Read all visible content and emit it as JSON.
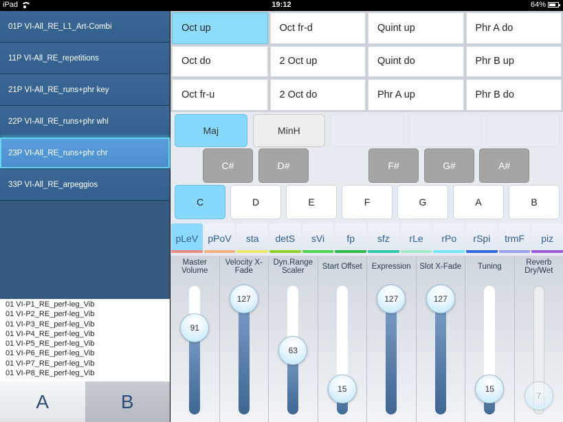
{
  "status_bar": {
    "device": "iPad",
    "time": "19:12",
    "battery": "64%",
    "battery_fraction": 0.64
  },
  "sidebar": {
    "presets": [
      {
        "label": "01P VI-All_RE_L1_Art-Combi",
        "selected": false
      },
      {
        "label": "11P VI-All_RE_repetitions",
        "selected": false
      },
      {
        "label": "21P VI-All_RE_runs+phr key",
        "selected": false
      },
      {
        "label": "22P VI-All_RE_runs+phr whl",
        "selected": false
      },
      {
        "label": "23P VI-All_RE_runs+phr chr",
        "selected": true
      },
      {
        "label": "33P VI-All_RE_arpeggios",
        "selected": false
      }
    ],
    "patches": [
      "01 VI-P1_RE_perf-leg_Vib",
      "01 VI-P2_RE_perf-leg_Vib",
      "01 VI-P3_RE_perf-leg_Vib",
      "01 VI-P4_RE_perf-leg_Vib",
      "01 VI-P5_RE_perf-leg_Vib",
      "01 VI-P6_RE_perf-leg_Vib",
      "01 VI-P7_RE_perf-leg_Vib",
      "01 VI-P8_RE_perf-leg_Vib"
    ],
    "ab": {
      "a_label": "A",
      "b_label": "B",
      "selected": "A"
    }
  },
  "patterns": {
    "items": [
      {
        "label": "Oct up",
        "active": true
      },
      {
        "label": "Oct fr-d",
        "active": false
      },
      {
        "label": "Quint up",
        "active": false
      },
      {
        "label": "Phr A do",
        "active": false
      },
      {
        "label": "Oct do",
        "active": false
      },
      {
        "label": "2 Oct up",
        "active": false
      },
      {
        "label": "Quint do",
        "active": false
      },
      {
        "label": "Phr B up",
        "active": false
      },
      {
        "label": "Oct fr-u",
        "active": false
      },
      {
        "label": "2 Oct do",
        "active": false
      },
      {
        "label": "Phr A up",
        "active": false
      },
      {
        "label": "Phr B do",
        "active": false
      }
    ]
  },
  "scales": {
    "items": [
      {
        "label": "Maj",
        "state": "active"
      },
      {
        "label": "MinH",
        "state": "normal"
      },
      {
        "label": "",
        "state": "empty"
      },
      {
        "label": "",
        "state": "empty"
      },
      {
        "label": "",
        "state": "empty"
      }
    ]
  },
  "keys": {
    "black": [
      "C#",
      "D#",
      "F#",
      "G#",
      "A#"
    ],
    "white": [
      "C",
      "D",
      "E",
      "F",
      "G",
      "A",
      "B"
    ],
    "selected": "C"
  },
  "articulations": {
    "items": [
      {
        "label": "pLeV",
        "color": "#f08a80",
        "active": true
      },
      {
        "label": "pPoV",
        "color": "#f5b082",
        "active": false
      },
      {
        "label": "sta",
        "color": "#ece86a",
        "active": false
      },
      {
        "label": "detS",
        "color": "#8cd42a",
        "active": false
      },
      {
        "label": "sVi",
        "color": "#4fd64f",
        "active": false
      },
      {
        "label": "fp",
        "color": "#2db84a",
        "active": false
      },
      {
        "label": "sfz",
        "color": "#2ec8a8",
        "active": false
      },
      {
        "label": "rLe",
        "color": "#a2e8c8",
        "active": false
      },
      {
        "label": "rPo",
        "color": "#72e6f2",
        "active": false
      },
      {
        "label": "rSpi",
        "color": "#2e6ad8",
        "active": false
      },
      {
        "label": "trmF",
        "color": "#9aa2ee",
        "active": false
      },
      {
        "label": "piz",
        "color": "#9b5ad8",
        "active": false
      }
    ]
  },
  "sliders": {
    "max": 127,
    "items": [
      {
        "label": "Master Volume",
        "value": 91,
        "enabled": true
      },
      {
        "label": "Velocity X-Fade",
        "value": 127,
        "enabled": true
      },
      {
        "label": "Dyn.Range Scaler",
        "value": 63,
        "enabled": true
      },
      {
        "label": "Start Offset",
        "value": 15,
        "enabled": true
      },
      {
        "label": "Expression",
        "value": 127,
        "enabled": true
      },
      {
        "label": "Slot X-Fade",
        "value": 127,
        "enabled": true
      },
      {
        "label": "Tuning",
        "value": 15,
        "enabled": true
      },
      {
        "label": "Reverb Dry/Wet",
        "value": 7,
        "enabled": false
      }
    ]
  }
}
